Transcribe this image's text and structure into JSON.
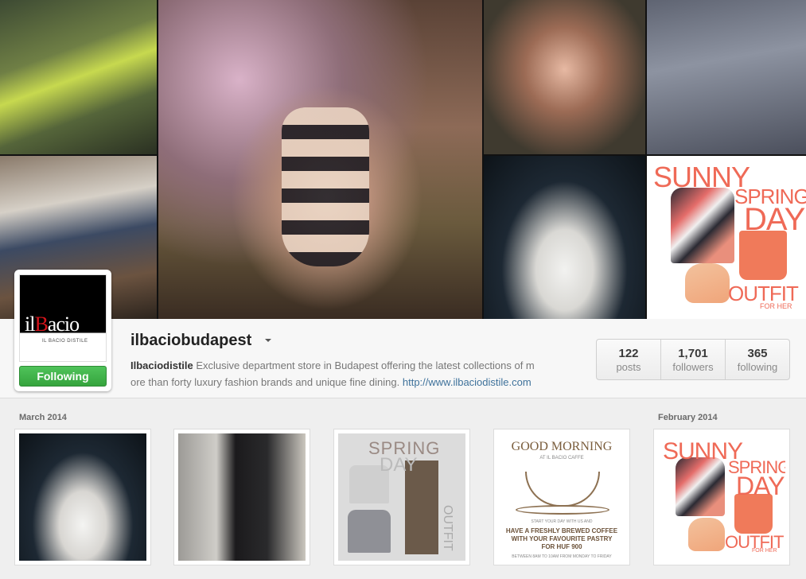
{
  "profile": {
    "username": "ilbaciobudapest",
    "avatar": {
      "logo_prefix": "il",
      "logo_heart": "B",
      "logo_suffix": "acio",
      "logo_sub": "IL BACIO DISTILE"
    },
    "follow_button": "Following",
    "bio": {
      "name": "Ilbaciodistile",
      "text_line1": "Exclusive department store in Budapest offering the latest collections of m",
      "text_line2": "ore than forty luxury fashion brands and unique fine dining.",
      "link": "http://www.ilbaciodistile.com"
    },
    "stats": [
      {
        "count": "122",
        "label": "posts"
      },
      {
        "count": "1,701",
        "label": "followers"
      },
      {
        "count": "365",
        "label": "following"
      }
    ]
  },
  "cover": {
    "sunny_tile": {
      "line1": "SUNNY",
      "line2": "SPRING",
      "line3": "DAY",
      "line4": "OUTFIT",
      "line5": "FOR HER"
    }
  },
  "feed": {
    "months": [
      "March 2014",
      "February 2014"
    ],
    "posts": [
      {
        "kind": "photo"
      },
      {
        "kind": "photo"
      },
      {
        "kind": "graphic",
        "title": "SPRING",
        "day": "DAY",
        "side": "OUTFIT"
      },
      {
        "kind": "graphic",
        "title": "GOOD MORNING",
        "sub": "AT IL BACIO CAFFE",
        "small": "START YOUR DAY WITH US AND",
        "line1": "HAVE A FRESHLY BREWED COFFEE",
        "line2": "WITH YOUR FAVOURITE PASTRY",
        "line3": "FOR HUF 900",
        "footer": "BETWEEN 8AM TO 10AM FROM MONDAY TO FRIDAY"
      },
      {
        "kind": "graphic",
        "line1": "SUNNY",
        "line2": "SPRING",
        "line3": "DAY",
        "line4": "OUTFIT",
        "line5": "FOR HER"
      }
    ]
  },
  "colors": {
    "follow_green": "#3fb54a",
    "link_blue": "#3f729b",
    "sunny_coral": "#ef6a57",
    "brand_red": "#d4141b"
  }
}
